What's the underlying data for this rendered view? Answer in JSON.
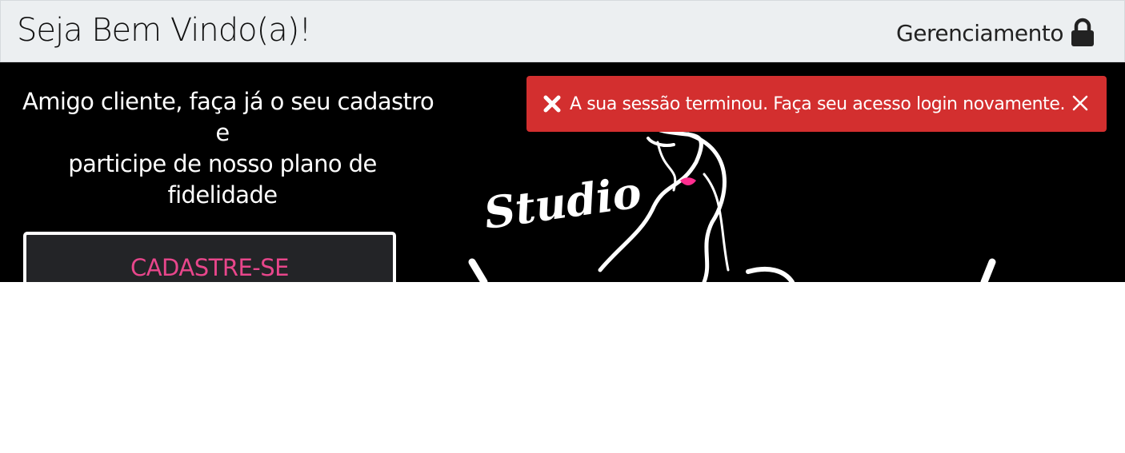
{
  "header": {
    "title": "Seja Bem Vindo(a)!",
    "management_label": "Gerenciamento",
    "management_icon": "lock-icon"
  },
  "intro": {
    "line1": "Amigo cliente, faça já o seu cadastro",
    "line2": "e",
    "line3": "participe de nosso plano de",
    "line4": "fidelidade"
  },
  "cta": {
    "label": "CADASTRE-SE",
    "color": "#e8468b"
  },
  "background_art": {
    "logo_text": "Studio"
  },
  "alert": {
    "message": "A sua sessão terminou. Faça seu acesso login novamente.",
    "status_icon": "x-icon",
    "close_icon": "close-icon",
    "color": "#d32f2f"
  }
}
